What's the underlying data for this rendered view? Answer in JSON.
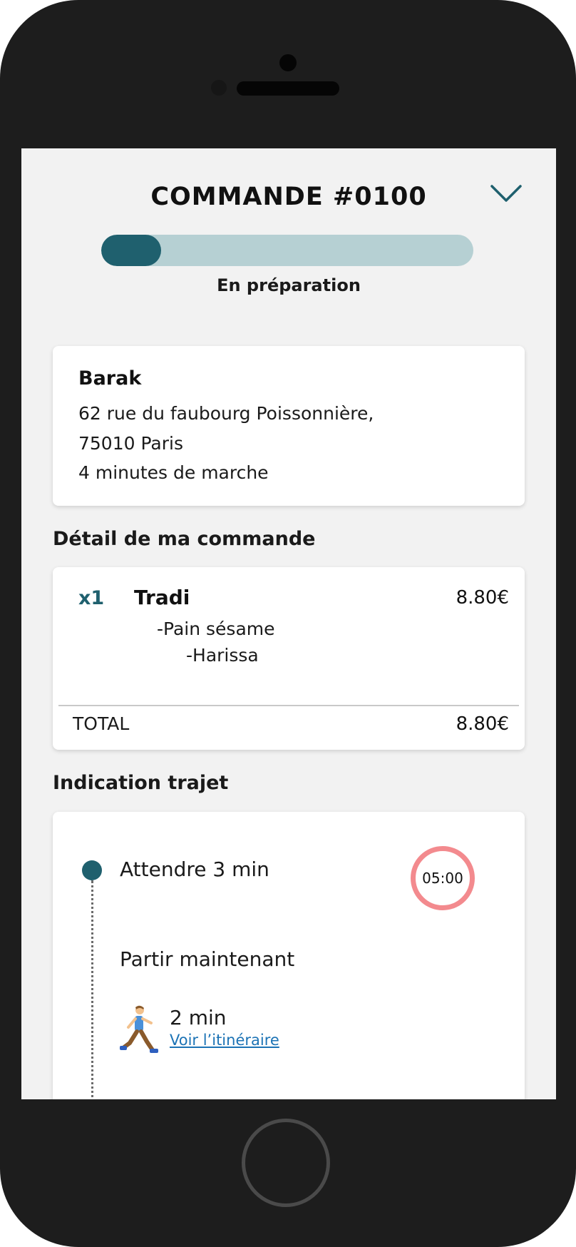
{
  "header": {
    "title": "COMMANDE #0100",
    "status": "En préparation",
    "progress_fraction": 0.16
  },
  "restaurant": {
    "name": "Barak",
    "address_line1": "62 rue du faubourg Poissonnière,",
    "address_line2": "75010 Paris",
    "walk_distance": "4 minutes de marche"
  },
  "order": {
    "section_title": "Détail de ma commande",
    "items": [
      {
        "qty": "x1",
        "name": "Tradi",
        "price": "8.80€",
        "options": [
          "-Pain sésame",
          "-Harissa"
        ]
      }
    ],
    "total_label": "TOTAL",
    "total_value": "8.80€"
  },
  "trip": {
    "section_title": "Indication trajet",
    "wait_step": "Attendre 3 min",
    "timer": "05:00",
    "leave_step": "Partir maintenant",
    "walk_duration": "2 min",
    "route_link": "Voir l’itinéraire"
  },
  "icons": {
    "chevron": "chevron-down-icon",
    "walker": "walking-person-icon"
  },
  "colors": {
    "accent": "#1f606e",
    "progress_track": "#b6d0d3",
    "timer_ring": "#f38a8e",
    "link": "#1c73b5",
    "screen_background": "#f2f2f2",
    "device_body": "#1d1d1d"
  }
}
